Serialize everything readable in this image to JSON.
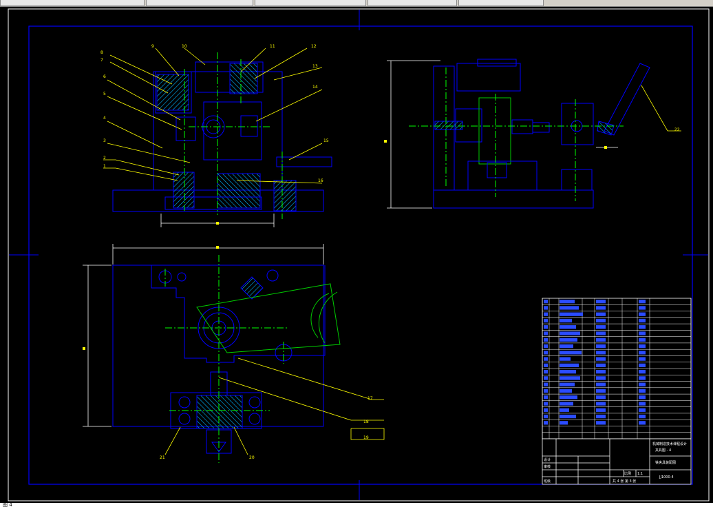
{
  "window": {
    "status_text": "图 4"
  },
  "colors": {
    "background": "#000000",
    "outline": "#0000ff",
    "centerline": "#00ff00",
    "leader": "#ffff00",
    "hatch": "#00ccff",
    "border": "#ffffff"
  },
  "callouts": [
    "1",
    "2",
    "3",
    "4",
    "5",
    "6",
    "7",
    "8",
    "9",
    "10",
    "11",
    "12",
    "13",
    "14",
    "15",
    "16",
    "17",
    "18",
    "19",
    "20",
    "21",
    "22"
  ],
  "title_block": {
    "title_line1": "机械制造技术课程设计",
    "title_line2": "夹具图 - 4",
    "drawing_name": "铣夹具装配图",
    "drawing_no": "JJ1000-4",
    "scale_label": "比例",
    "scale_value": "1:1",
    "sheet_info": "共 4 张  第 3 张",
    "designer_label": "设计",
    "checker_label": "审核",
    "class_label": "班级"
  }
}
